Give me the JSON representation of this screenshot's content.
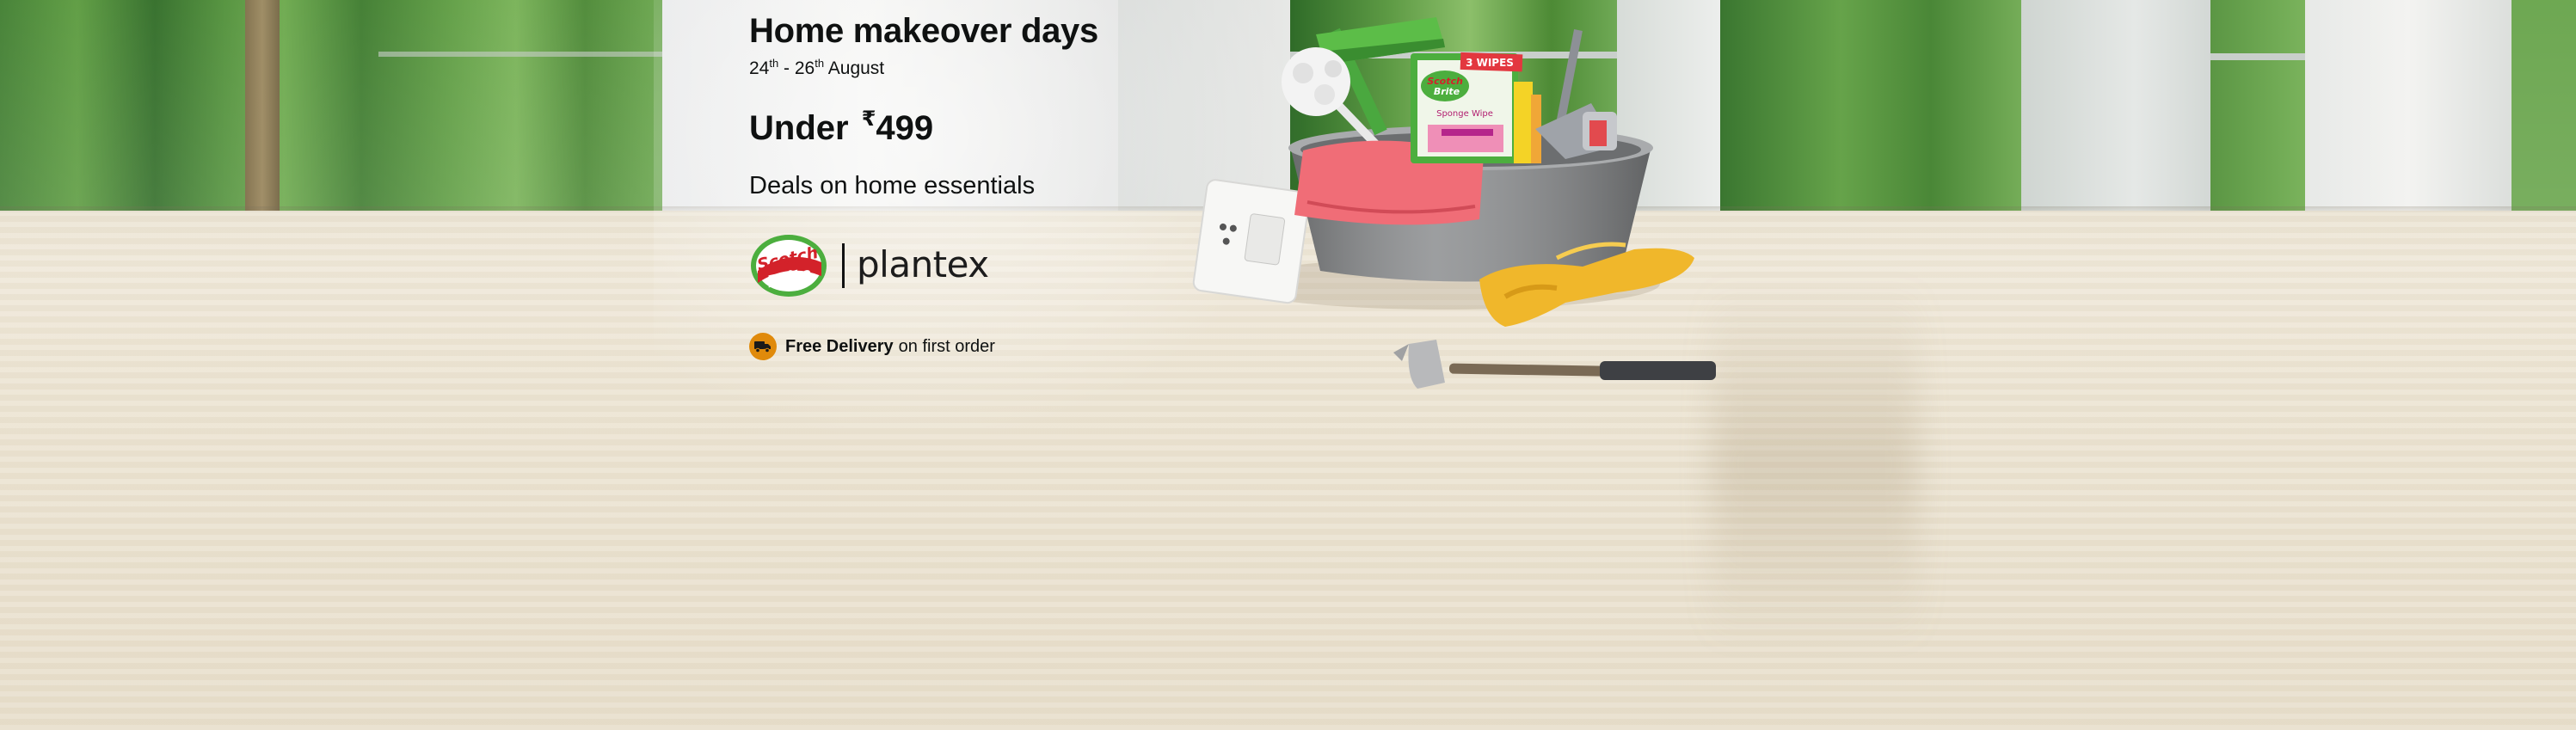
{
  "banner": {
    "title": "Home makeover days",
    "dates": {
      "start_day": "24",
      "start_suffix": "th",
      "separator": " - ",
      "end_day": "26",
      "end_suffix": "th",
      "month": " August"
    },
    "price": {
      "prefix": "Under ",
      "currency_symbol": "₹",
      "amount": "499"
    },
    "subtitle": "Deals on home essentials",
    "brands": {
      "scotch_line1": "Scotch",
      "scotch_line2": "Brite",
      "plantex": "plantex"
    },
    "delivery": {
      "bold": "Free Delivery",
      "rest": "on first order",
      "icon": "truck-icon"
    },
    "product_pack": {
      "badge": "3 WIPES",
      "brand_line1": "Scotch",
      "brand_line2": "Brite",
      "product_name": "Sponge Wipe"
    }
  },
  "colors": {
    "text": "#0f1111",
    "delivery_badge": "#e08a0b",
    "scotch_red": "#d3222a",
    "scotch_green": "#4cae3e"
  }
}
